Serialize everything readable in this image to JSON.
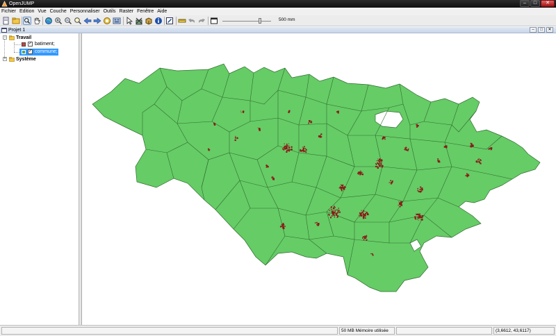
{
  "window": {
    "title": "OpenJUMP",
    "minimize_glyph": "–",
    "maximize_glyph": "□",
    "close_glyph": "✕"
  },
  "menu": [
    "Fichier",
    "Edition",
    "Vue",
    "Couche",
    "Personnaliser",
    "Outils",
    "Raster",
    "Fenêtre",
    "Aide"
  ],
  "toolbar": {
    "zoom_scale": "500 mm",
    "icons": [
      "new-project-icon",
      "open-project-icon",
      "zoom-tool-icon",
      "pan-tool-icon",
      "zoom-full-icon",
      "zoom-in-icon",
      "zoom-out-icon",
      "zoom-selected-icon",
      "zoom-previous-icon",
      "zoom-next-icon",
      "zoom-to-fence-icon",
      "refresh-icon",
      "select-icon",
      "delete-icon",
      "feature-info-icon",
      "info-icon",
      "edit-toolbox-icon",
      "measure-icon",
      "undo-icon",
      "redo-icon",
      "window-icon"
    ]
  },
  "frame": {
    "title": "Projet 1",
    "minimize_glyph": "–",
    "maximize_glyph": "□",
    "close_glyph": "✕"
  },
  "tree": {
    "categories": [
      {
        "label": "Travail",
        "expand": "−"
      },
      {
        "label": "Système",
        "expand": "+"
      }
    ],
    "layers": [
      {
        "label": "batiment;",
        "color": "#d34040",
        "checked": "✓"
      },
      {
        "label": "commune;",
        "color": "#4ea866",
        "checked": "✓"
      }
    ]
  },
  "map": {
    "fill_color": "#66cc66",
    "stroke_color": "#2f6b2f",
    "building_color": "#8b1a1a"
  },
  "statusbar": {
    "memory": "50 MB Mémoire utilisée",
    "coords": "(3,6612, 43,6117)"
  }
}
